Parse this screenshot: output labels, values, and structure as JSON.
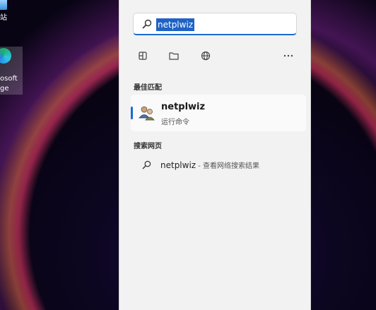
{
  "desktop": {
    "recycle_label": "站",
    "edge_label_line1": "osoft",
    "edge_label_line2": "ge"
  },
  "search": {
    "query": "netplwiz"
  },
  "filters": {
    "icons": [
      "apps-icon",
      "folder-icon",
      "globe-icon",
      "more-icon"
    ]
  },
  "best_match": {
    "section_title": "最佳匹配",
    "app_name": "netplwiz",
    "app_type": "运行命令"
  },
  "web": {
    "section_title": "搜索网页",
    "query": "netplwiz",
    "hint": " - 查看网络搜索结果"
  },
  "colors": {
    "accent": "#1a6bd1",
    "panel_bg": "#f2f2f2"
  }
}
